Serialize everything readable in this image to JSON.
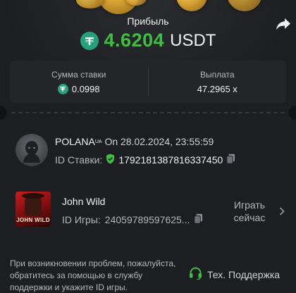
{
  "header": {
    "profit_label": "Прибыль",
    "profit_value": "4.6204",
    "profit_currency": "USDT",
    "profit_color": "#3fbf3f"
  },
  "summary": {
    "bet_amount_label": "Сумма ставки",
    "bet_amount_value": "0.0998",
    "payout_label": "Выплата",
    "payout_value": "47.2965 x"
  },
  "bet": {
    "username": "POLANA",
    "country_code": "UA",
    "date_text": "On 28.02.2024, 23:55:59",
    "bet_id_label": "ID Ставки:",
    "bet_id_value": "1792181387816337450"
  },
  "game": {
    "thumbnail_text": "JOHN WILD",
    "name": "John Wild",
    "game_id_label": "ID Игры:",
    "game_id_value": "24059789597625...",
    "play_label_line1": "Играть",
    "play_label_line2": "сейчас"
  },
  "footer": {
    "help_text": "При возникновении проблем, пожалуйста, обратитесь за помощью в службу поддержки и укажите ID игры.",
    "support_label": "Тех. Поддержка"
  },
  "icons": {
    "tether": "tether-icon",
    "share": "share-icon",
    "shield": "shield-check-icon",
    "copy": "copy-icon",
    "chevron": "chevron-right-icon",
    "headset": "headset-icon"
  },
  "colors": {
    "background": "#1c1e21",
    "tether": "#26a17b",
    "accent_green": "#3fbf3f",
    "muted_text": "#b5b7ba"
  }
}
